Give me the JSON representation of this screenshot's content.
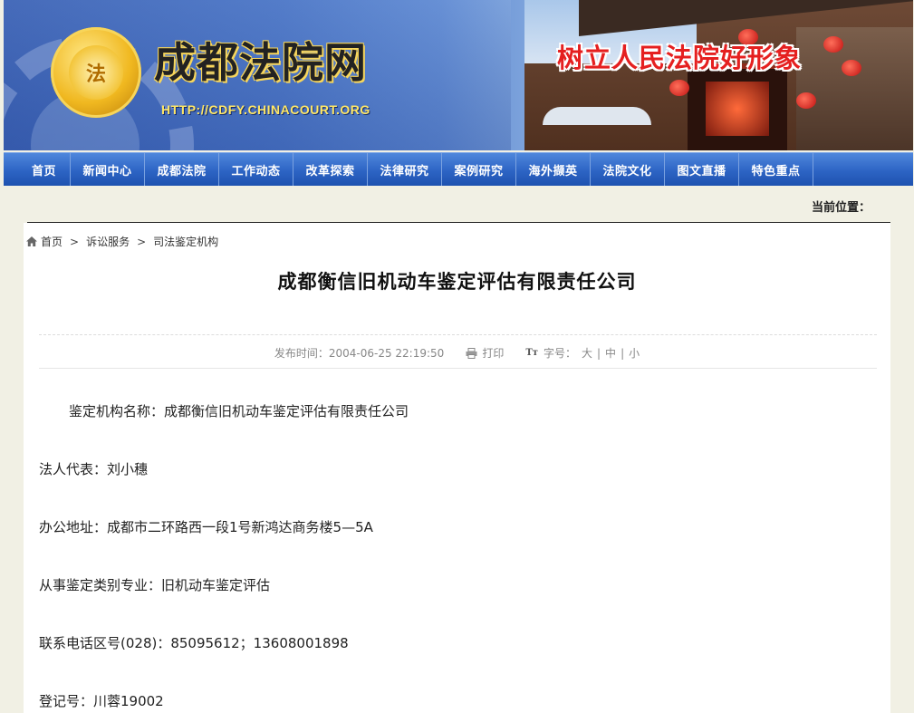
{
  "header": {
    "emblem_text": "法",
    "site_name": "成都法院网",
    "site_url": "HTTP://CDFY.CHINACOURT.ORG",
    "slogan": "树立人民法院好形象"
  },
  "nav": [
    {
      "label": "首页"
    },
    {
      "label": "新闻中心"
    },
    {
      "label": "成都法院"
    },
    {
      "label": "工作动态"
    },
    {
      "label": "改革探索"
    },
    {
      "label": "法律研究"
    },
    {
      "label": "案例研究"
    },
    {
      "label": "海外撷英"
    },
    {
      "label": "法院文化"
    },
    {
      "label": "图文直播"
    },
    {
      "label": "特色重点"
    }
  ],
  "location": {
    "label": "当前位置："
  },
  "breadcrumb": {
    "home": "首页",
    "items": [
      "诉讼服务",
      "司法鉴定机构"
    ]
  },
  "article": {
    "title": "成都衡信旧机动车鉴定评估有限责任公司",
    "meta": {
      "published": "发布时间：2004-06-25 22:19:50",
      "print": "打印",
      "font_size_label": "字号：",
      "size_large": "大",
      "size_medium": "中",
      "size_small": "小"
    },
    "paragraphs": [
      "鉴定机构名称：成都衡信旧机动车鉴定评估有限责任公司",
      "法人代表：刘小穗",
      "办公地址：成都市二环路西一段1号新鸿达商务楼5—5A",
      "从事鉴定类别专业：旧机动车鉴定评估",
      "联系电话区号(028)：85095612；13608001898",
      "登记号：川蓉19002"
    ]
  },
  "colors": {
    "nav_blue": "#2d64c4",
    "slogan_red": "#e52020",
    "background": "#f1f0e4"
  }
}
